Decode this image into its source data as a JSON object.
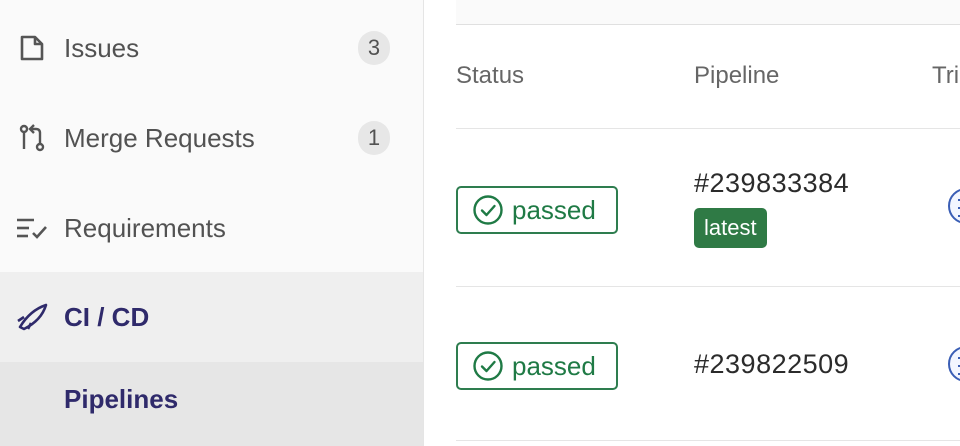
{
  "sidebar": {
    "items": [
      {
        "label": "Issues",
        "count": "3",
        "icon": "issues-icon"
      },
      {
        "label": "Merge Requests",
        "count": "1",
        "icon": "merge-request-icon"
      },
      {
        "label": "Requirements",
        "icon": "requirements-icon"
      },
      {
        "label": "CI / CD",
        "icon": "rocket-icon",
        "active": true
      }
    ],
    "subitems": [
      {
        "label": "Pipelines",
        "active": true
      }
    ]
  },
  "table": {
    "columns": [
      "Status",
      "Pipeline",
      "Tri"
    ],
    "rows": [
      {
        "status": "passed",
        "pipeline": "#239833384",
        "tag": "latest"
      },
      {
        "status": "passed",
        "pipeline": "#239822509"
      }
    ]
  },
  "colors": {
    "accent": "#2f2a6b",
    "success": "#1f7a45",
    "latest_badge": "#2f7a45",
    "sidebar_bg": "#fafafa"
  }
}
